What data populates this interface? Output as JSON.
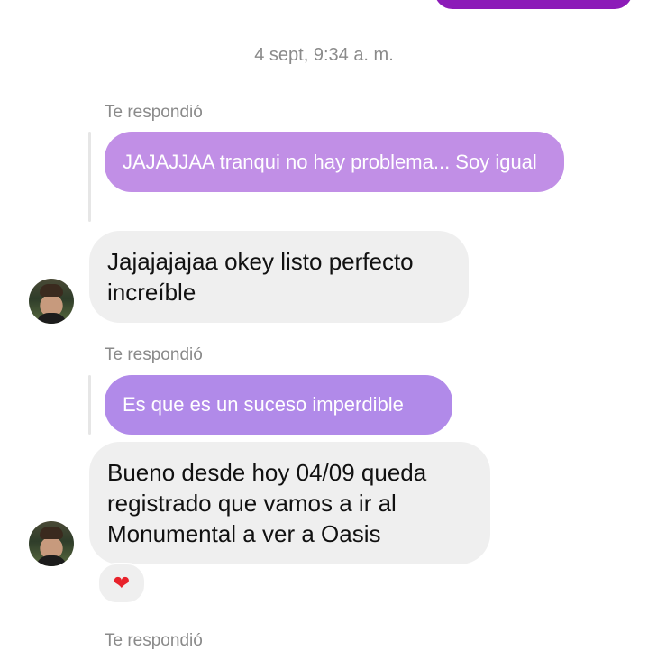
{
  "timestamp": "4 sept, 9:34 a. m.",
  "messages": [
    {
      "reply_label": "Te respondió",
      "reply_text": "JAJAJJAA tranqui no hay problema... Soy igual",
      "text": "Jajajajajaa okey listo perfecto increíble"
    },
    {
      "reply_label": "Te respondió",
      "reply_text": "Es que es un suceso imperdible",
      "text": "Bueno desde hoy 04/09 queda registrado que vamos a ir al Monumental a ver a Oasis",
      "reaction": "❤"
    }
  ],
  "next_reply_label": "Te respondió",
  "colors": {
    "sent_bubble": "#8c1bb8",
    "reply_light": "#c18fe6",
    "reply_medium": "#b18ae9",
    "received_bubble": "#efefef",
    "meta_text": "#8a8a8a",
    "heart": "#e8222b"
  }
}
